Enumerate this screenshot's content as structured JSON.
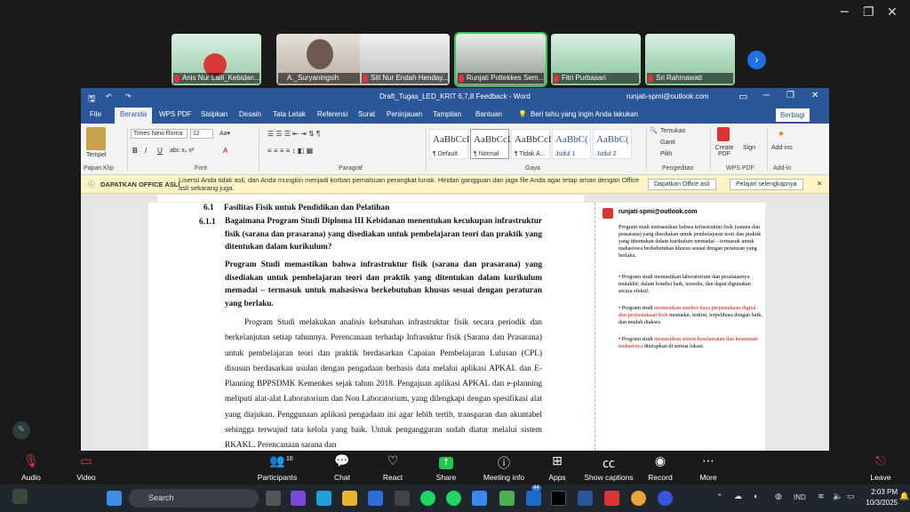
{
  "zoom": {
    "participants": [
      {
        "name": "Anis Nur Laili_Kebidan..."
      },
      {
        "name": "A._Suryaningsih"
      },
      {
        "name": "Siti Nur Endah Henday..."
      },
      {
        "name": "Runjati Poltekkes Sem..."
      },
      {
        "name": "Fitri Purbasari"
      },
      {
        "name": "Sri Rahmawati"
      }
    ],
    "toolbar": {
      "audio": "Audio",
      "video": "Video",
      "participants": "Participants",
      "participants_count": "16",
      "chat": "Chat",
      "react": "React",
      "share": "Share",
      "meeting_info": "Meeting info",
      "apps": "Apps",
      "captions": "Show captions",
      "record": "Record",
      "more": "More",
      "leave": "Leave"
    }
  },
  "word": {
    "title": "Draft_Tugas_LED_KRIT 6,7,8 Feedback  -  Word",
    "account": "runjati-spmi@outlook.com",
    "tabs": [
      "File",
      "Beranda",
      "WPS PDF",
      "Sisipkan",
      "Desain",
      "Tata Letak",
      "Referensi",
      "Surat",
      "Peninjauan",
      "Tampilan",
      "Bantuan"
    ],
    "tell_me": "Beri tahu yang ingin Anda lakukan",
    "share": "Berbagi",
    "ribbon": {
      "paste": "Tempel",
      "clipboard": "Papan Klip",
      "font_name": "Times New Roma",
      "font_size": "12",
      "font_group": "Font",
      "paragraph_group": "Paragraf",
      "styles_group": "Gaya",
      "styles": [
        {
          "sample": "AaBbCcI",
          "name": "¶ Default"
        },
        {
          "sample": "AaBbCcL",
          "name": "¶ Normal"
        },
        {
          "sample": "AaBbCcI",
          "name": "¶ Tidak A..."
        },
        {
          "sample": "AaBbC(",
          "name": "Judul 1"
        },
        {
          "sample": "AaBbC(",
          "name": "Judul 2"
        }
      ],
      "find": "Temukan",
      "replace": "Ganti",
      "select": "Pilih",
      "editing_group": "Pengeditan",
      "create_pdf": "Create PDF",
      "sign": "Sign",
      "wps_group": "WPS PDF",
      "addins": "Add-ins",
      "addins_group": "Add-in"
    },
    "infobar": {
      "title": "DAPATKAN OFFICE ASLI",
      "message": "Lisensi Anda tidak asli, dan Anda mungkin menjadi korban pemalsuan perangkat lunak. Hindari gangguan dan jaga file Anda agar tetap aman dengan Office asli sekarang juga.",
      "btn1": "Dapatkan Office asli",
      "btn2": "Pelajari selengkapnya"
    },
    "document": {
      "heading_num": "6.1",
      "heading": "Fasilitas Fisik untuk Pendidikan dan Pelatihan",
      "q_num": "6.1.1",
      "question": "Bagaimana Program Studi Diploma III Kebidanan menentukan kecukupan infrastruktur fisik (sarana dan prasarana) yang disediakan untuk pembelajaran teori dan praktik yang ditentukan dalam kurikulum?",
      "answer_bold": "Program Studi memastikan bahwa infrastruktur fisik (sarana dan prasarana) yang disediakan untuk pembelajaran teori dan praktik yang ditentukan dalam kurikulum memadai – termasuk untuk mahasiswa berkebutuhan khusus sesuai dengan peraturan yang berlaku.",
      "para1": "Program Studi melakukan analisis kebutuhan infrastruktur fisik secara periodik dan berkelanjutan setiap tahunnya. Perencanaan terhadap Infrasuktur fisik (Sarana dan Prasarana) untuk pembelajaran teori dan praktik berdasarkan Capaian Pembelajaran Lulusan (CPL) disusun berdasarkan usulan dengan pengadaan berbasis data melalui aplikasi APKAL dan E-Planning BPPSDMK Kemenkes sejak tahun 2018. Pengajuan aplikasi APKAL dan e-planning meliputi alat-alat Laboratorium dan Non Laboratorium, yang dilengkapi dengan spesifikasi alat yang diajukan. Penggunaan aplikasi pengadaan ini agar lebih tertib, transparan dan akuntabel sehingga terwujud tata kelola yang baik. Untuk penganggaran sudah diatur melalui sistem RKAKL. Perencanaan sarana dan"
    },
    "comment": {
      "author": "runjati-spmi@outlook.com",
      "intro": "Program studi memastikan bahwa infrastruktur fisik (sarana dan prasarana) yang disediakan untuk pembelajaran teori dan praktik yang ditentukan dalam kurikulum memadai – termasuk untuk mahasiswa berkebutuhan khusus sesuai dengan peraturan yang berlaku.",
      "b1": "• Program studi memastikan laboratorium dan peralatannya mutakhir, dalam kondisi baik, tersedia, dan dapat digunakan secara efektif.",
      "b2_pre": "• Program studi ",
      "b2_red": "memastikan sumber daya perpustakaan digital dan perpustakaan fisik",
      "b2_post": " memadai, terkini, terpelihara dengan baik, dan mudah diakses.",
      "b3_pre": "• Program studi ",
      "b3_red": "memastikan sistem keselamatan dan keamanan mahasiswa",
      "b3_post": " diterapkan di semua lokasi."
    }
  },
  "taskbar": {
    "search": "Search",
    "lang": "IND",
    "time": "2:03 PM",
    "date": "10/3/2025",
    "badge": "44"
  },
  "colors": {
    "word_blue": "#2b579a",
    "zoom_share": "#23c552",
    "zoom_bg": "#1a1a1a"
  }
}
